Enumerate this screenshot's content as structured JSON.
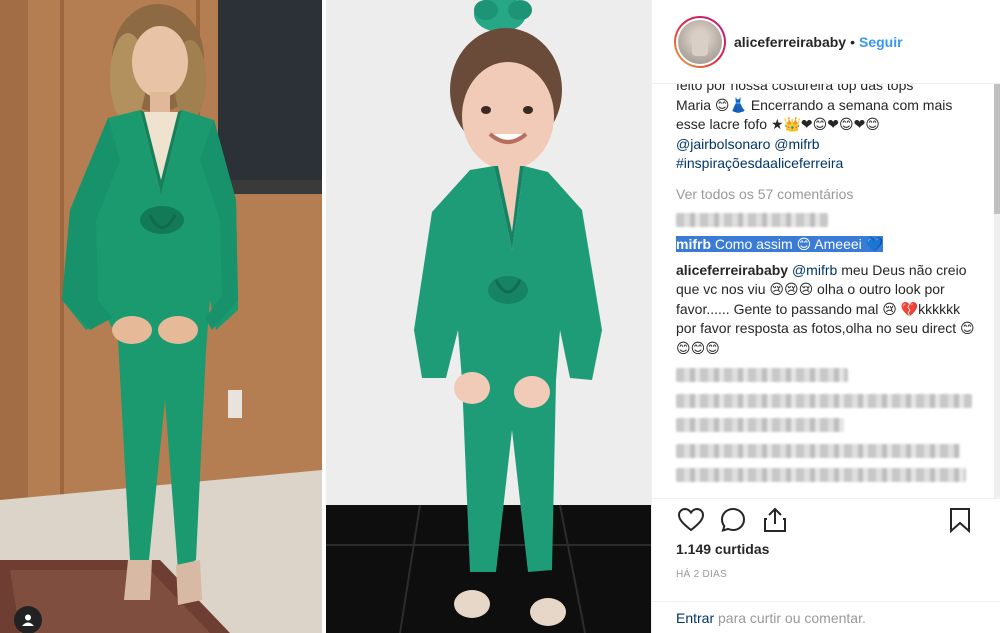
{
  "post": {
    "username": "aliceferreirababy",
    "dot": "•",
    "follow_label": "Seguir",
    "caption_line1": "feito por nossa costureira top das tops",
    "caption_line2": "Maria 😊👗 Encerrando a semana com mais",
    "caption_line3": "esse lacre fofo ★👑❤😊❤😊❤😊",
    "caption_mentions": "@jairbolsonaro @mifrb",
    "caption_hashtag": "#inspiraçõesdaaliceferreira",
    "view_all_comments": "Ver todos os 57 comentários",
    "highlighted_comment": {
      "user": "mifrb",
      "text": "Como assim 😊 Ameeei 💙"
    },
    "reply_comment": {
      "user": "aliceferreirababy",
      "mention": "@mifrb",
      "text": "meu Deus não creio que vc nos viu 😢😢😢 olha o outro look por favor...... Gente to passando mal 😢 💔kkkkkk por favor resposta as fotos,olha no seu direct 😊😊😊😊"
    },
    "likes": "1.149 curtidas",
    "time": "HÁ 2 DIAS",
    "login_prompt": {
      "link": "Entrar",
      "rest": " para curtir ou comentar."
    }
  },
  "colors": {
    "accent_link": "#3897f0",
    "mention": "#003569",
    "dress_green": "#1a9a6e",
    "highlight": "#3a7bd5"
  },
  "icons": [
    "heart-icon",
    "comment-icon",
    "share-icon",
    "bookmark-icon",
    "user-tag-icon"
  ]
}
